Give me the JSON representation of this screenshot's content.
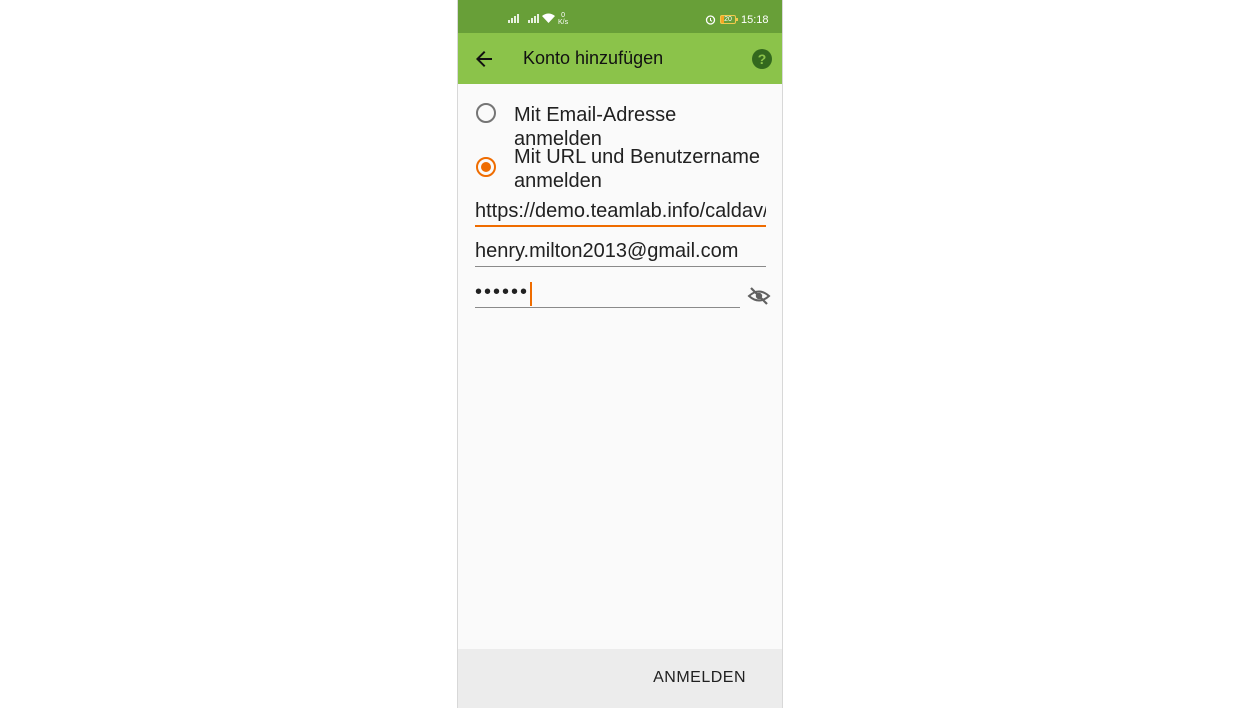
{
  "status_bar": {
    "network_speed_value": "0",
    "network_speed_unit": "K/s",
    "battery": "20",
    "time": "15:18"
  },
  "app_bar": {
    "title": "Konto hinzufügen",
    "back_icon": "arrow-back-icon",
    "help_icon": "help-circle-icon",
    "help_glyph": "?",
    "background": "#8bc34a",
    "status_background": "#689f38"
  },
  "login_options": [
    {
      "label": "Mit Email-Adresse anmelden",
      "selected": false
    },
    {
      "label": "Mit URL und Benutzername anmelden",
      "selected": true
    }
  ],
  "form": {
    "url_value": "https://demo.teamlab.info/caldav/",
    "username_value": "henry.milton2013@gmail.com",
    "password_masked": "••••••",
    "password_visibility_icon": "eye-off-icon"
  },
  "footer": {
    "login_label": "ANMELDEN"
  },
  "accent_color": "#ef6c00"
}
